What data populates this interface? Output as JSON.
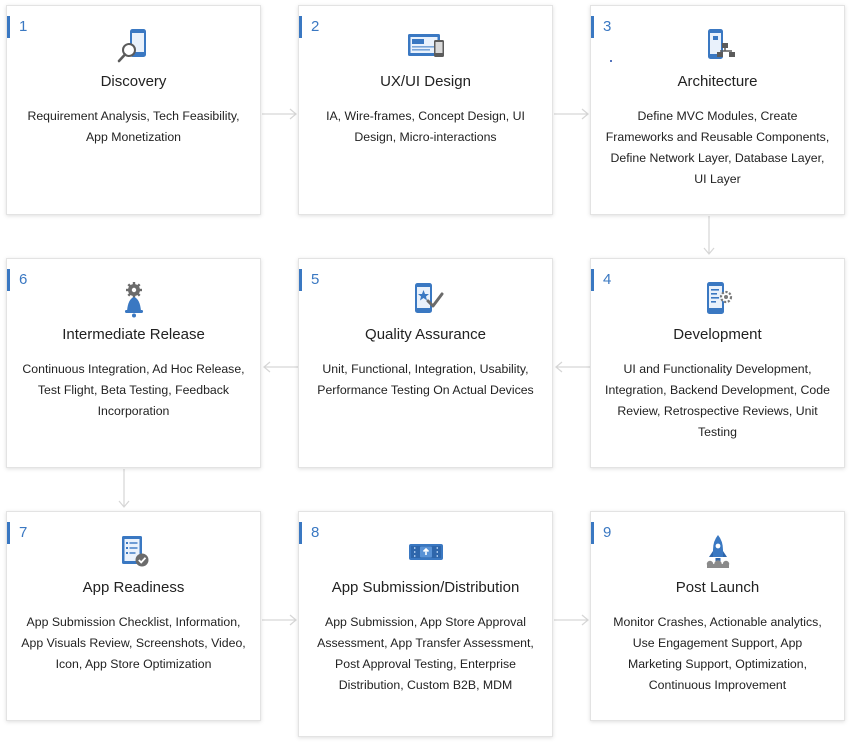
{
  "steps": [
    {
      "num": "1",
      "title": "Discovery",
      "desc": "Requirement Analysis, Tech Feasibility, App Monetization",
      "icon": "phone-search-icon"
    },
    {
      "num": "2",
      "title": "UX/UI Design",
      "desc": "IA, Wire-frames, Concept Design, UI Design, Micro-interactions",
      "icon": "wireframe-screens-icon"
    },
    {
      "num": "3",
      "title": "Architecture",
      "desc": "Define MVC Modules, Create Frameworks and Reusable Components, Define Network Layer, Database Layer, UI Layer",
      "icon": "phone-sitemap-icon"
    },
    {
      "num": "4",
      "title": "Development",
      "desc": "UI and Functionality Development, Integration, Backend Development, Code Review, Retrospective Reviews, Unit Testing",
      "icon": "phone-gear-icon"
    },
    {
      "num": "5",
      "title": "Quality Assurance",
      "desc": "Unit, Functional, Integration, Usability, Performance Testing On Actual Devices",
      "icon": "phone-star-check-icon"
    },
    {
      "num": "6",
      "title": "Intermediate Release",
      "desc": "Continuous Integration, Ad Hoc Release, Test Flight, Beta Testing, Feedback Incorporation",
      "icon": "bell-gear-icon"
    },
    {
      "num": "7",
      "title": "App Readiness",
      "desc": "App Submission Checklist, Information, App Visuals Review, Screenshots, Video, Icon, App Store Optimization",
      "icon": "checklist-icon"
    },
    {
      "num": "8",
      "title": "App Submission/Distribution",
      "desc": "App Submission, App Store Approval Assessment, App Transfer Assessment, Post Approval Testing, Enterprise Distribution, Custom B2B, MDM",
      "icon": "upload-device-icon"
    },
    {
      "num": "9",
      "title": "Post Launch",
      "desc": "Monitor Crashes, Actionable analytics, Use Engagement Support, App Marketing Support, Optimization, Continuous Improvement",
      "icon": "rocket-launch-icon"
    }
  ],
  "colors": {
    "accent": "#3a78c2",
    "connector": "#d6d6d6"
  }
}
